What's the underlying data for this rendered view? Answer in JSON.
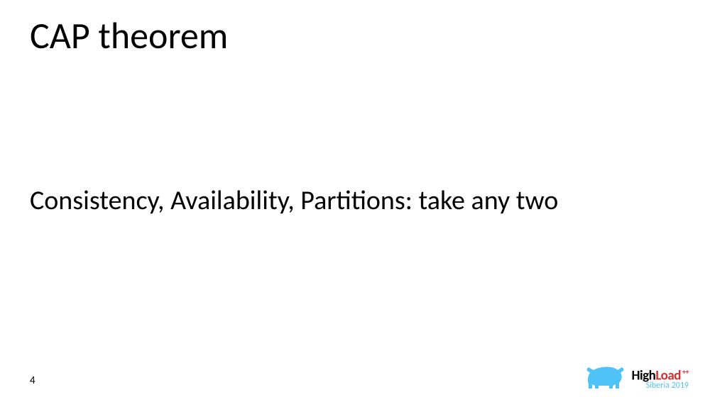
{
  "slide": {
    "title": "CAP theorem",
    "body": "Consistency, Availability, Partitions: take any two",
    "page_number": "4"
  },
  "footer": {
    "logo_high": "High",
    "logo_load": "Load",
    "logo_plus": "++",
    "logo_sub": "Siberia 2019"
  }
}
